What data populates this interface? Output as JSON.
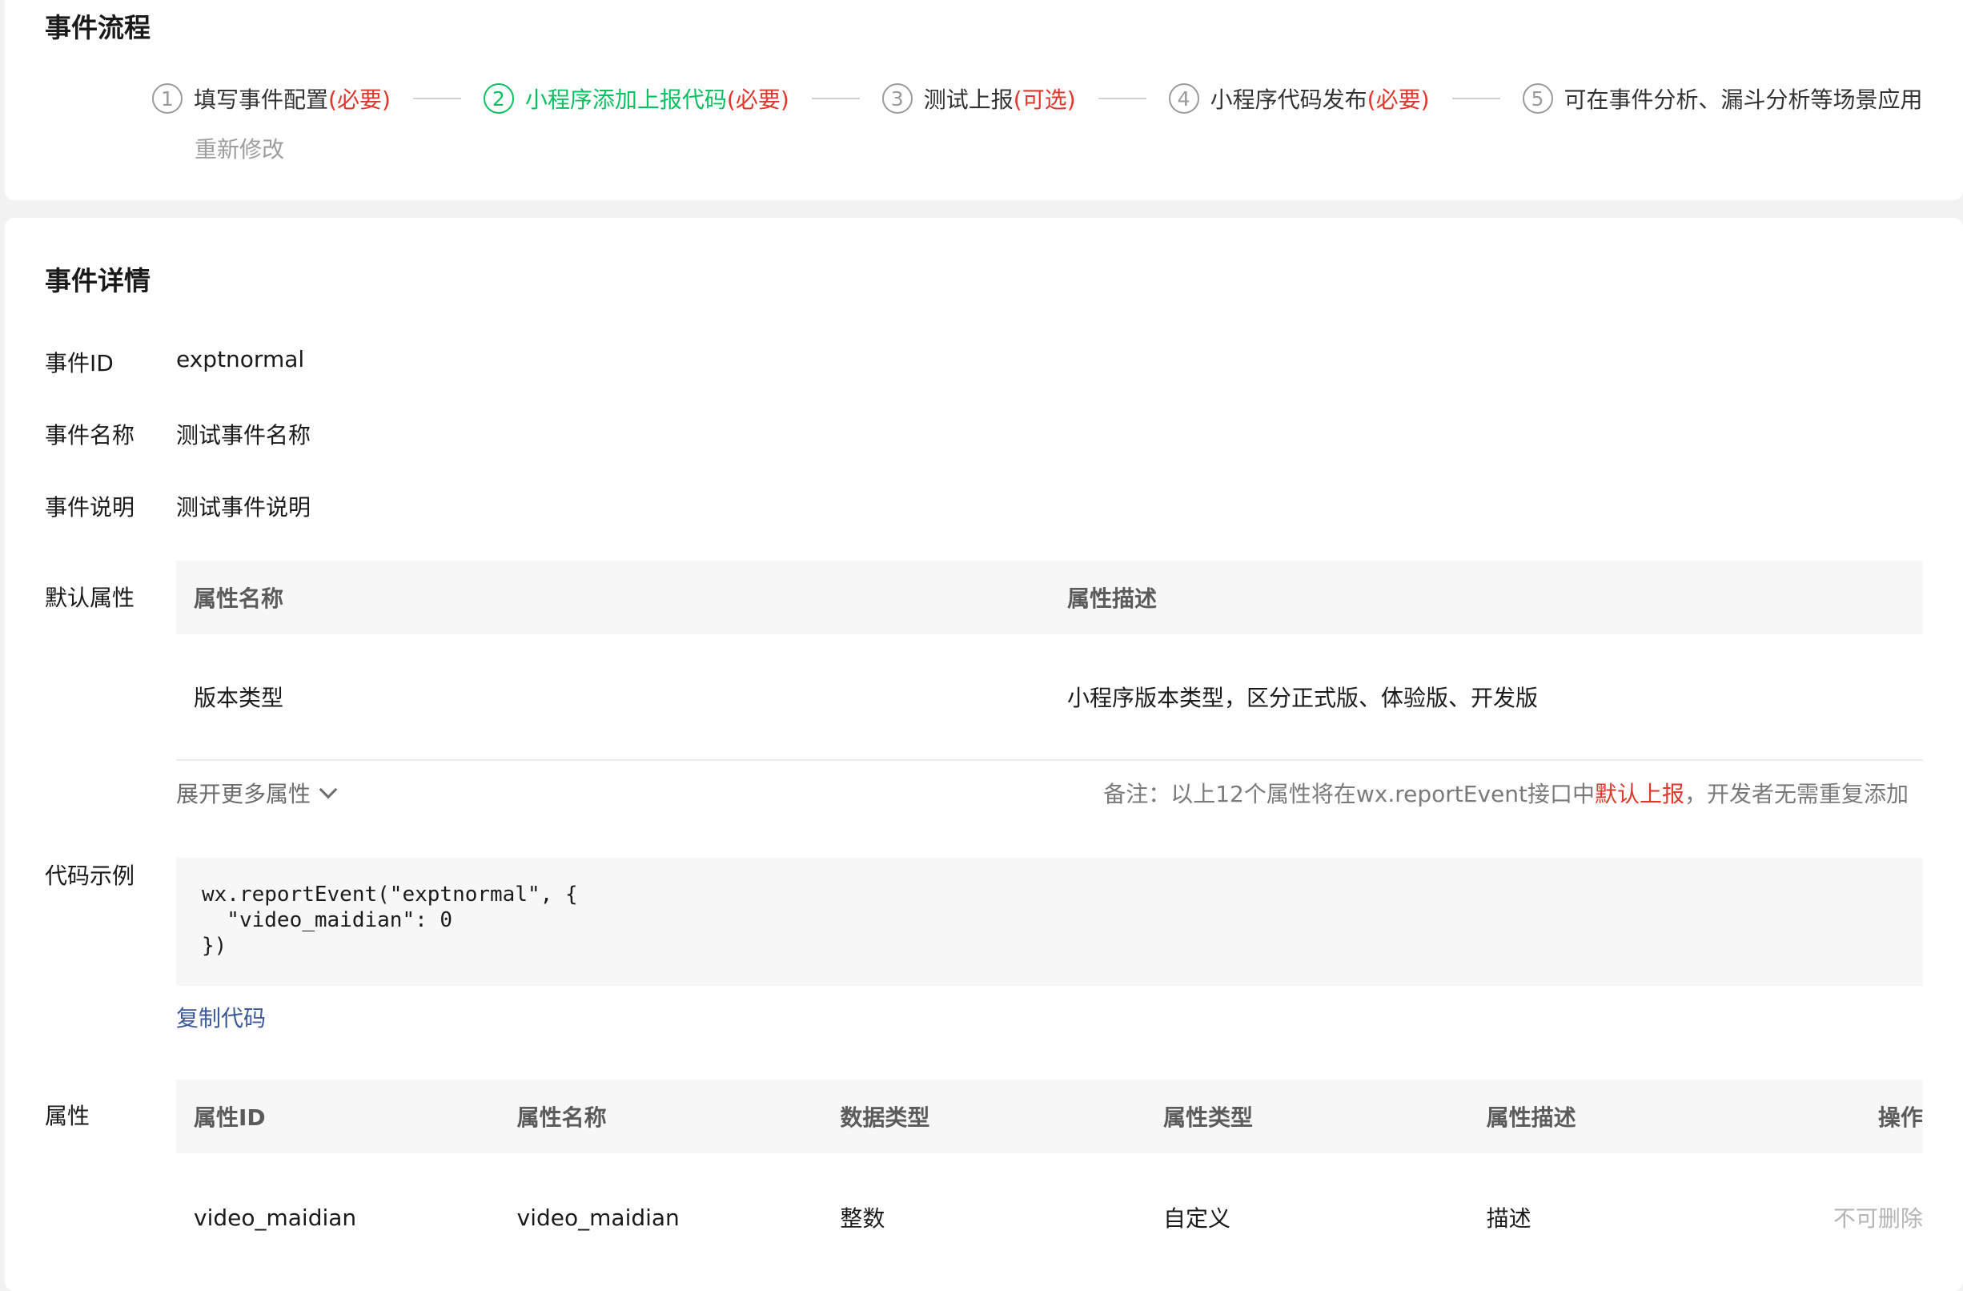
{
  "flow": {
    "title": "事件流程",
    "steps": [
      {
        "num": "1",
        "label": "填写事件配置",
        "tag": " (必要)"
      },
      {
        "num": "2",
        "label": "小程序添加上报代码",
        "tag": "(必要)"
      },
      {
        "num": "3",
        "label": "测试上报",
        "tag": "(可选)"
      },
      {
        "num": "4",
        "label": "小程序代码发布",
        "tag": "(必要)"
      },
      {
        "num": "5",
        "label": "可在事件分析、漏斗分析等场景应用",
        "tag": ""
      }
    ],
    "active_step": 2,
    "re_edit": "重新修改"
  },
  "detail": {
    "title": "事件详情",
    "event_id": {
      "label": "事件ID",
      "value": "exptnormal"
    },
    "event_name": {
      "label": "事件名称",
      "value": "测试事件名称"
    },
    "event_desc": {
      "label": "事件说明",
      "value": "测试事件说明"
    },
    "default_props": {
      "label": "默认属性",
      "headers": [
        "属性名称",
        "属性描述"
      ],
      "rows": [
        [
          "版本类型",
          "小程序版本类型，区分正式版、体验版、开发版"
        ]
      ],
      "more": "展开更多属性",
      "note_prefix": "备注：以上12个属性将在wx.reportEvent接口中",
      "note_highlight": "默认上报",
      "note_suffix": "，开发者无需重复添加"
    },
    "code_example": {
      "label": "代码示例",
      "code": "wx.reportEvent(\"exptnormal\", {\n  \"video_maidian\": 0\n})",
      "copy": "复制代码"
    },
    "props": {
      "label": "属性",
      "headers": [
        "属性ID",
        "属性名称",
        "数据类型",
        "属性类型",
        "属性描述",
        "操作"
      ],
      "rows": [
        [
          "video_maidian",
          "video_maidian",
          "整数",
          "自定义",
          "描述",
          "不可删除"
        ]
      ]
    }
  },
  "colors": {
    "active_green": "#07c160",
    "required_red": "#e0362b",
    "link_blue": "#3d5999"
  }
}
